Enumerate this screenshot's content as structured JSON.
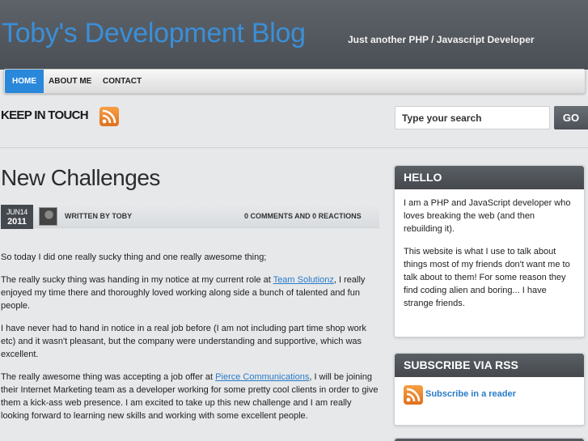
{
  "site": {
    "title": "Toby's Development Blog",
    "tagline": "Just another PHP / Javascript Developer"
  },
  "nav": [
    {
      "label": "HOME",
      "active": true
    },
    {
      "label": "ABOUT ME",
      "active": false
    },
    {
      "label": "CONTACT",
      "active": false
    }
  ],
  "keep_in_touch": {
    "label": "KEEP IN TOUCH",
    "icon": "rss-icon"
  },
  "search": {
    "placeholder": "Type your search",
    "button": "GO"
  },
  "post": {
    "title": "New Challenges",
    "date_month": "JUN14",
    "date_year": "2011",
    "author": "WRITTEN BY TOBY",
    "comments": "0 COMMENTS AND 0 REACTIONS",
    "p1": "So today I did one really sucky thing and one really awesome thing;",
    "p2_a": "The really sucky thing was handing in my notice at my current role at ",
    "p2_link": "Team Solutionz",
    "p2_b": ", I really enjoyed my time there and thoroughly loved working along side a bunch of talented and fun people.",
    "p3": "I have never had to hand in notice in a real job before (I am not including part time shop work etc) and it wasn't pleasant, but the company were understanding and supportive, which was excellent.",
    "p4_a": "The really awesome thing was accepting a job offer at ",
    "p4_link": "Pierce Communications",
    "p4_b": ", I will be joining their Internet Marketing team as a developer working for some pretty cool clients in order to give them a kick-ass web presence.  I am excited to take up this new challenge and I am really looking forward to learning new skills and working with some excellent people."
  },
  "sidebar": {
    "hello": {
      "title": "HELLO",
      "p1": "I am a PHP and JavaScript developer who loves breaking the web (and then rebuilding it).",
      "p2": "This website is what I use to talk about things most of my friends don't want me to talk about to them! For some reason they find coding alien and boring... I have strange friends."
    },
    "subscribe": {
      "title": "SUBSCRIBE VIA RSS",
      "link": "Subscribe in a reader"
    }
  },
  "colors": {
    "accent": "#2a88db",
    "title_blue": "#3a8fd8",
    "header_bg": "#50555b",
    "link": "#2a7bc8",
    "rss_orange": "#e8802a"
  }
}
